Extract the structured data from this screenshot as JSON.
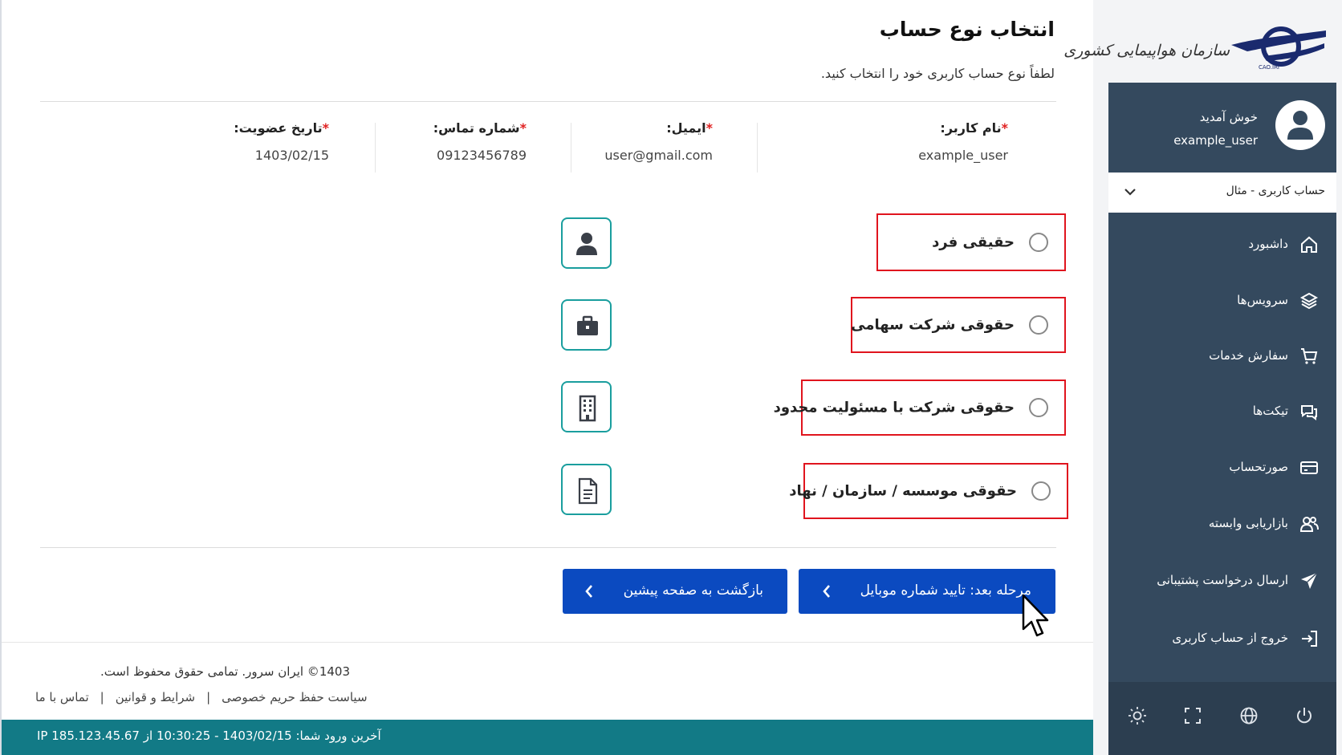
{
  "brand": {
    "logo_text": "سازمان هواپیمایی کشوری",
    "logo_sub": "CAO.IRI"
  },
  "sidebar": {
    "welcome": "خوش آمدید",
    "username": "example_user",
    "account_select": "حساب کاربری - مثال",
    "items": [
      {
        "label": "داشبورد",
        "icon": "home-icon"
      },
      {
        "label": "سرویس‌ها",
        "icon": "layers-icon"
      },
      {
        "label": "سفارش خدمات",
        "icon": "cart-icon"
      },
      {
        "label": "تیکت‌ها",
        "icon": "chat-icon"
      },
      {
        "label": "صورتحساب",
        "icon": "credit-card-icon"
      },
      {
        "label": "بازاریابی وابسته",
        "icon": "users-icon"
      },
      {
        "label": "ارسال درخواست پشتیبانی",
        "icon": "send-icon"
      },
      {
        "label": "خروج از حساب کاربری",
        "icon": "logout-icon"
      }
    ],
    "footer_icons": [
      "sun-icon",
      "fullscreen-icon",
      "globe-icon",
      "power-icon"
    ]
  },
  "page": {
    "title": "انتخاب نوع حساب",
    "subtitle": "لطفاً نوع حساب کاربری خود را انتخاب کنید."
  },
  "info": {
    "username": {
      "label": "نام کاربر:",
      "value": "example_user"
    },
    "email": {
      "label": "ایمیل:",
      "value": "user@gmail.com"
    },
    "phone": {
      "label": "شماره تماس:",
      "value": "09123456789"
    },
    "member_since": {
      "label": "تاریخ عضویت:",
      "value": "1403/02/15"
    },
    "required_mark": "*"
  },
  "options": [
    {
      "label": "حقیقی فرد",
      "icon": "person-icon"
    },
    {
      "label": "حقوقی شرکت سهامی",
      "icon": "briefcase-icon"
    },
    {
      "label": "حقوقی شرکت با مسئولیت محدود",
      "icon": "building-icon"
    },
    {
      "label": "حقوقی موسسه / سازمان / نهاد",
      "icon": "document-icon"
    }
  ],
  "buttons": {
    "next": "مرحله بعد: تایید شماره موبایل",
    "back": "بازگشت به صفحه پیشین"
  },
  "footer": {
    "copyright": "1403© ایران سرور. تمامی حقوق محفوظ است.",
    "links": [
      "سیاست حفظ حریم خصوصی",
      "شرایط و قوانین",
      "تماس با ما"
    ],
    "last_login": "آخرین ورود شما: 1403/02/15 - 10:30:25 از IP 185.123.45.67"
  },
  "colors": {
    "sidebar_bg": "#34495e",
    "primary_button": "#0b4ac0",
    "status_bar": "#127a86",
    "highlight_border": "#e0141e",
    "icon_border": "#1a9e9e"
  }
}
